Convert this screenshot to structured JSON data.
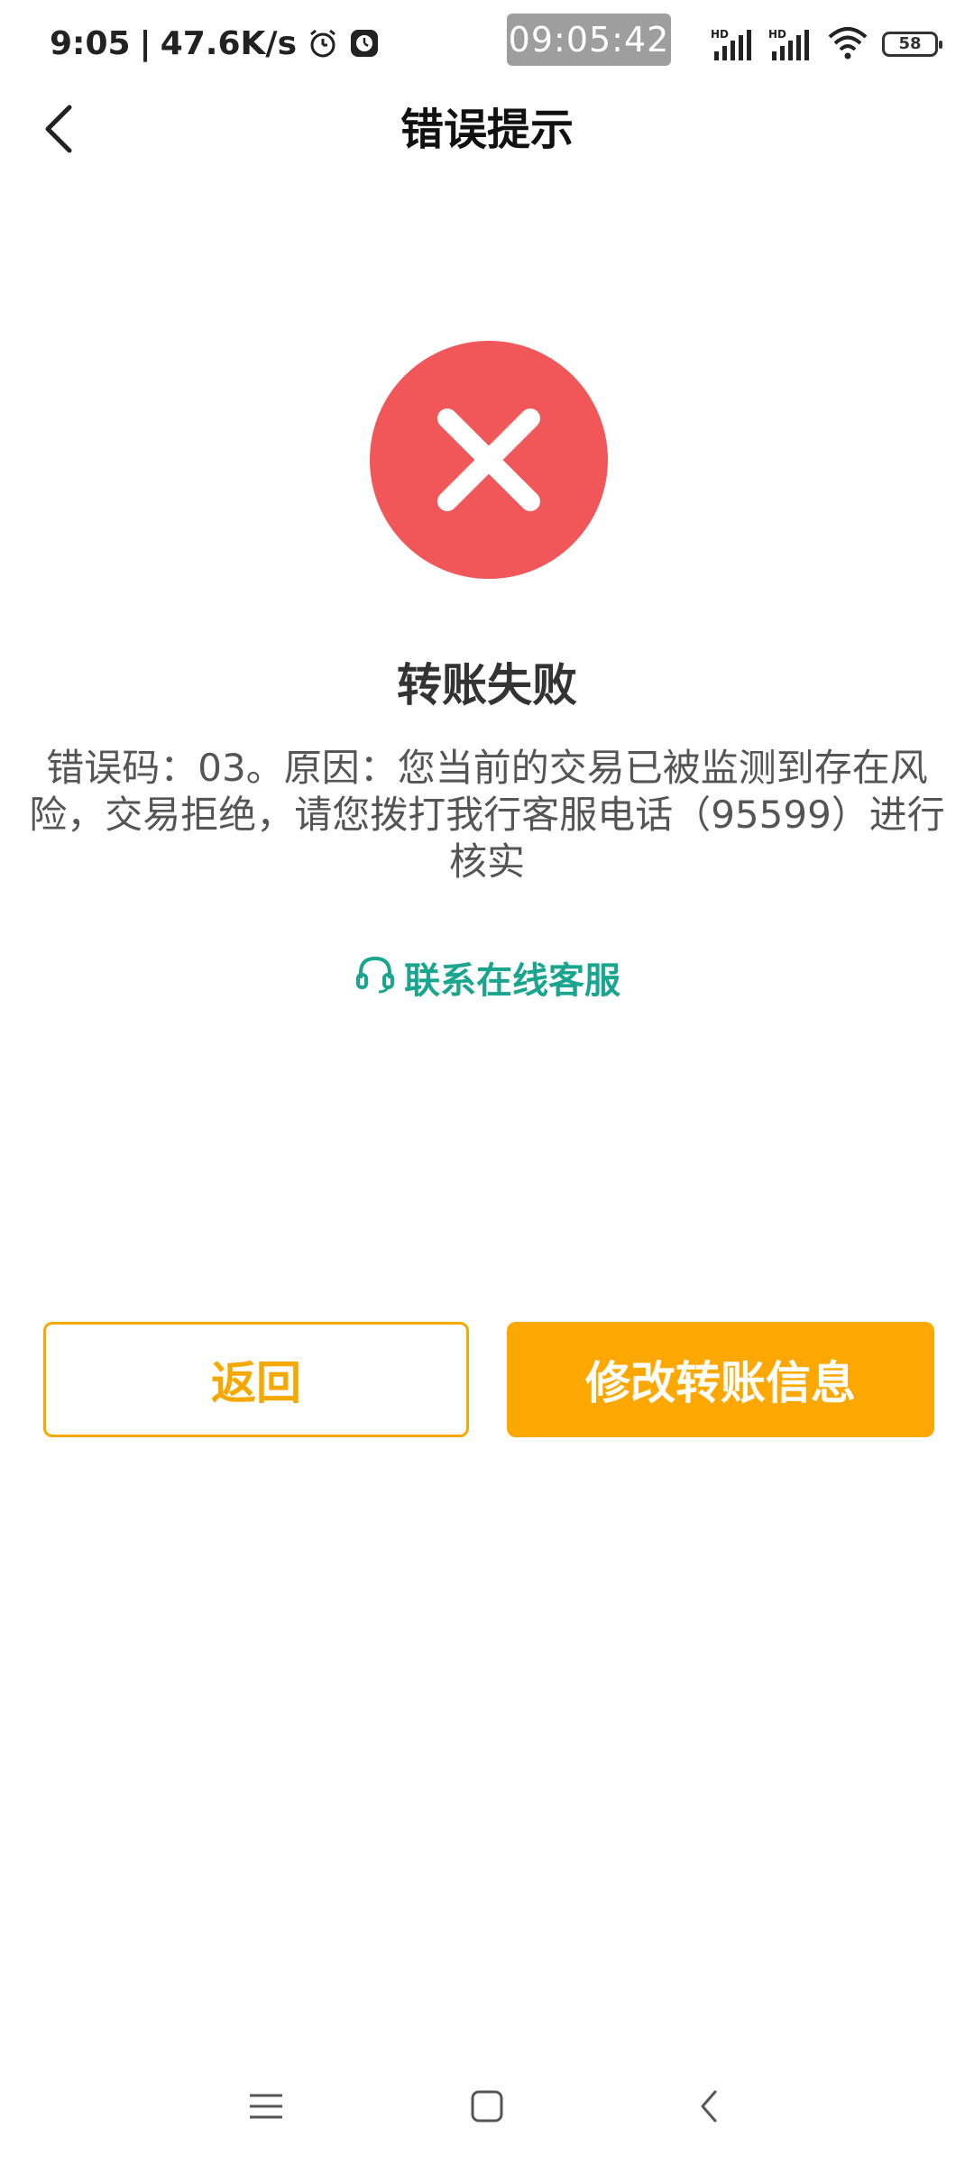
{
  "status_bar": {
    "time": "9:05",
    "separator": "|",
    "net_speed": "47.6K/s",
    "clock_badge": "09:05:42",
    "sim1_label": "HD",
    "sim2_label": "HD",
    "battery": "58",
    "icons": [
      "alarm-icon",
      "app-notification-icon",
      "signal-icon",
      "signal-icon",
      "wifi-icon",
      "battery-icon"
    ]
  },
  "header": {
    "title": "错误提示",
    "back_icon": "chevron-left-icon"
  },
  "result": {
    "icon": "error-x-icon",
    "icon_color": "#f15659",
    "title": "转账失败",
    "message": "错误码：03。原因：您当前的交易已被监测到存在风险，交易拒绝，请您拨打我行客服电话（95599）进行核实"
  },
  "support": {
    "icon": "headset-icon",
    "label": "联系在线客服",
    "color": "#19a58e"
  },
  "actions": {
    "back_label": "返回",
    "modify_label": "修改转账信息",
    "accent": "#fda800"
  },
  "nav_bar": {
    "icons": [
      "menu-icon",
      "home-icon",
      "back-icon"
    ]
  }
}
